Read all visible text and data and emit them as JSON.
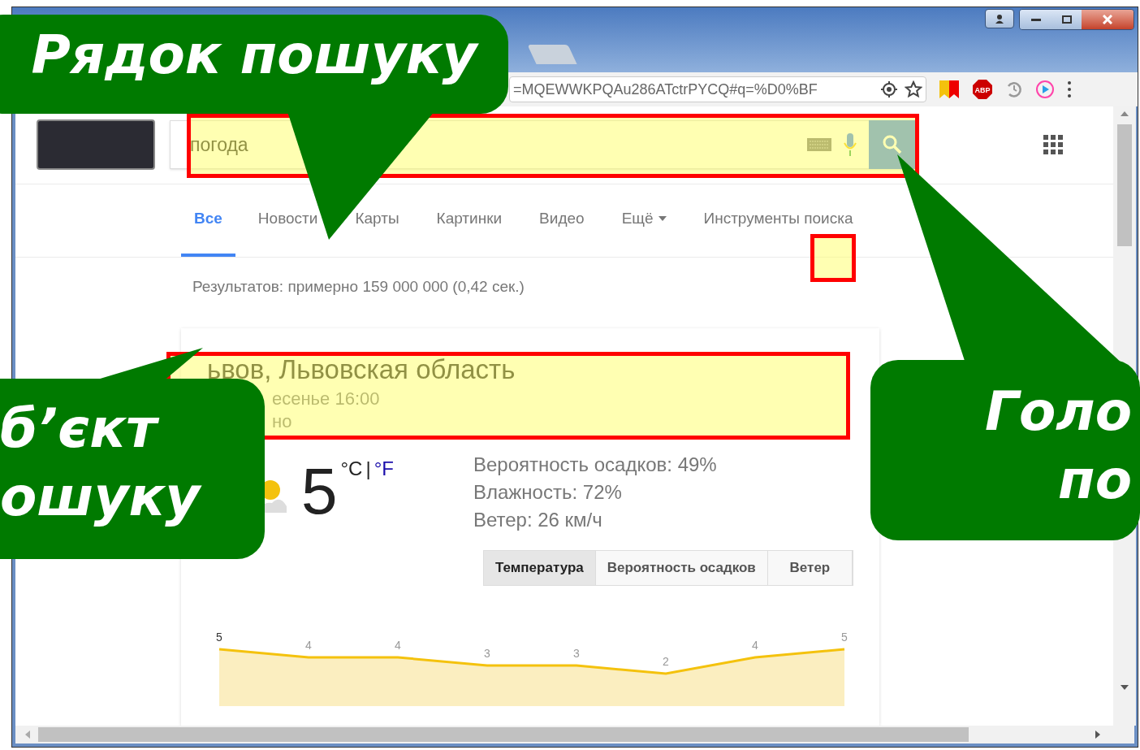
{
  "browser": {
    "address": "=MQEWWKPQAu286ATctrPYCQ#q=%D0%BF",
    "adblock_label": "ABP"
  },
  "search": {
    "query": "погода"
  },
  "search_tabs": [
    {
      "label": "Все",
      "selected": true,
      "kind": "tab"
    },
    {
      "label": "Новости",
      "selected": false,
      "kind": "tab"
    },
    {
      "label": "Карты",
      "selected": false,
      "kind": "tab"
    },
    {
      "label": "Картинки",
      "selected": false,
      "kind": "tab"
    },
    {
      "label": "Видео",
      "selected": false,
      "kind": "tab"
    },
    {
      "label": "Ещё",
      "selected": false,
      "kind": "menu"
    },
    {
      "label": "Инструменты поиска",
      "selected": false,
      "kind": "tab"
    }
  ],
  "results_count": "Результатов: примерно 159 000 000 (0,42 сек.)",
  "weather": {
    "location": "ьвов, Львовская область",
    "time": "есенье 16:00",
    "condition": "но",
    "temperature": "5",
    "units": [
      {
        "label": "°C",
        "selected": true
      },
      {
        "label": "°F",
        "selected": false
      }
    ],
    "unit_separator": "|",
    "details": [
      "Вероятность осадков: 49%",
      "Влажность: 72%",
      "Ветер: 26 км/ч"
    ],
    "tabs": [
      {
        "label": "Температура",
        "selected": true
      },
      {
        "label": "Вероятность осадков",
        "selected": false
      },
      {
        "label": "Ветер",
        "selected": false
      }
    ],
    "chart_data": {
      "type": "area",
      "categories": [
        null,
        null,
        null,
        null,
        null,
        null,
        null,
        null
      ],
      "series": [
        {
          "color": "#f4c20d",
          "values": [
            5,
            4,
            4,
            3,
            3,
            2,
            4,
            5
          ]
        }
      ],
      "data_labels": true
    }
  },
  "callouts": [
    {
      "lines": [
        "Рядок пошуку"
      ],
      "kind": "top"
    },
    {
      "lines": [
        "б’єкт",
        "ошуку"
      ],
      "kind": "left"
    },
    {
      "lines": [
        "Голо",
        "по"
      ],
      "kind": "right"
    }
  ]
}
